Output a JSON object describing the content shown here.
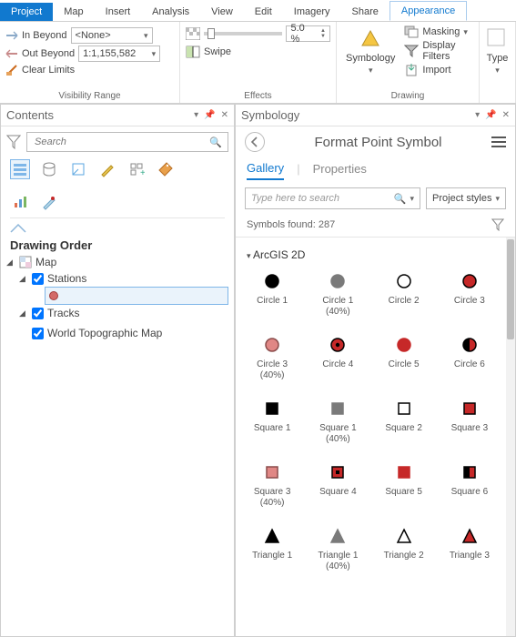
{
  "ribbon": {
    "tabs": [
      "Project",
      "Map",
      "Insert",
      "Analysis",
      "View",
      "Edit",
      "Imagery",
      "Share",
      "Appearance"
    ],
    "active_tab": "Appearance",
    "visibility": {
      "in_beyond": "In Beyond",
      "out_beyond": "Out Beyond",
      "clear_limits": "Clear Limits",
      "in_beyond_value": "<None>",
      "out_beyond_value": "1:1,155,582",
      "group_title": "Visibility Range"
    },
    "effects": {
      "transparency_pct": "5.0 %",
      "swipe_label": "Swipe",
      "group_title": "Effects"
    },
    "drawing": {
      "symbology_label": "Symbology",
      "masking_label": "Masking",
      "display_filters_label": "Display Filters",
      "import_label": "Import",
      "group_title": "Drawing"
    },
    "type_label": "Type"
  },
  "contents": {
    "title": "Contents",
    "search_placeholder": "Search",
    "section": "Drawing Order",
    "tree": {
      "root": "Map",
      "stations": "Stations",
      "tracks": "Tracks",
      "basemap": "World Topographic Map"
    }
  },
  "symbology": {
    "title": "Symbology",
    "page_title": "Format Point Symbol",
    "tabs": {
      "gallery": "Gallery",
      "properties": "Properties"
    },
    "search_placeholder": "Type here to search",
    "project_styles": "Project styles",
    "found_label": "Symbols found: 287",
    "group_heading": "ArcGIS 2D",
    "symbols": [
      {
        "name": "Circle 1",
        "sub": "",
        "shape": "circle",
        "fill": "#000",
        "stroke": "#000"
      },
      {
        "name": "Circle 1",
        "sub": "(40%)",
        "shape": "circle",
        "fill": "#7a7a7a",
        "stroke": "#7a7a7a"
      },
      {
        "name": "Circle 2",
        "sub": "",
        "shape": "circle",
        "fill": "none",
        "stroke": "#000"
      },
      {
        "name": "Circle 3",
        "sub": "",
        "shape": "circle",
        "fill": "#c62828",
        "stroke": "#000"
      },
      {
        "name": "Circle 3",
        "sub": "(40%)",
        "shape": "circle",
        "fill": "#e08785",
        "stroke": "#8a4c4b"
      },
      {
        "name": "Circle 4",
        "sub": "",
        "shape": "circle-dot",
        "fill": "#c62828",
        "stroke": "#000"
      },
      {
        "name": "Circle 5",
        "sub": "",
        "shape": "circle",
        "fill": "#c62828",
        "stroke": "#c62828"
      },
      {
        "name": "Circle 6",
        "sub": "",
        "shape": "circle-half",
        "fill": "#c62828",
        "stroke": "#000"
      },
      {
        "name": "Square 1",
        "sub": "",
        "shape": "square",
        "fill": "#000",
        "stroke": "#000"
      },
      {
        "name": "Square 1",
        "sub": "(40%)",
        "shape": "square",
        "fill": "#7a7a7a",
        "stroke": "#7a7a7a"
      },
      {
        "name": "Square 2",
        "sub": "",
        "shape": "square",
        "fill": "none",
        "stroke": "#000"
      },
      {
        "name": "Square 3",
        "sub": "",
        "shape": "square",
        "fill": "#c62828",
        "stroke": "#000"
      },
      {
        "name": "Square 3",
        "sub": "(40%)",
        "shape": "square",
        "fill": "#e08785",
        "stroke": "#8a4c4b"
      },
      {
        "name": "Square 4",
        "sub": "",
        "shape": "square-dot",
        "fill": "#c62828",
        "stroke": "#000"
      },
      {
        "name": "Square 5",
        "sub": "",
        "shape": "square",
        "fill": "#c62828",
        "stroke": "#c62828"
      },
      {
        "name": "Square 6",
        "sub": "",
        "shape": "square-half",
        "fill": "#c62828",
        "stroke": "#000"
      },
      {
        "name": "Triangle 1",
        "sub": "",
        "shape": "triangle",
        "fill": "#000",
        "stroke": "#000"
      },
      {
        "name": "Triangle 1",
        "sub": "(40%)",
        "shape": "triangle",
        "fill": "#7a7a7a",
        "stroke": "#7a7a7a"
      },
      {
        "name": "Triangle 2",
        "sub": "",
        "shape": "triangle",
        "fill": "none",
        "stroke": "#000"
      },
      {
        "name": "Triangle 3",
        "sub": "",
        "shape": "triangle",
        "fill": "#c62828",
        "stroke": "#000"
      }
    ]
  }
}
